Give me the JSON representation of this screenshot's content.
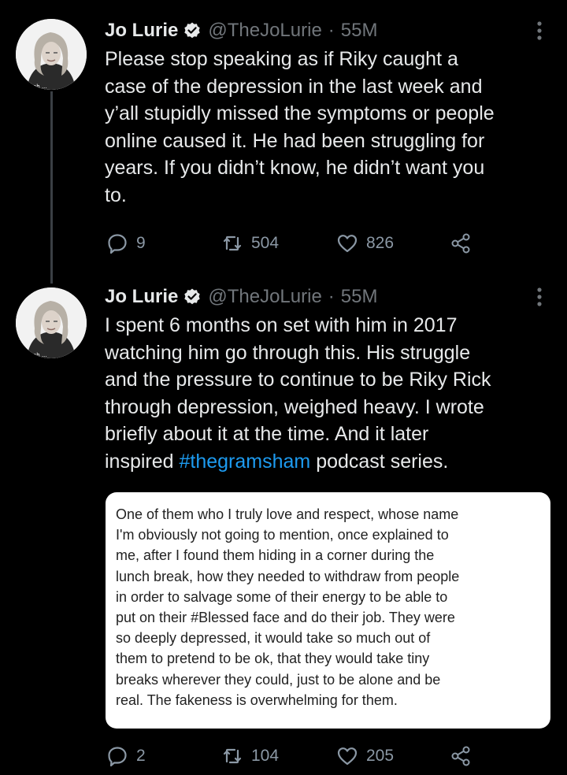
{
  "tweets": [
    {
      "author_name": "Jo Lurie",
      "handle": "@TheJoLurie",
      "separator": "·",
      "time": "55M",
      "lines": [
        "Please stop speaking as if Riky caught a",
        "case of the depression in the last week and",
        "y’all stupidly missed the symptoms or people",
        "online caused it. He had been struggling for",
        "years. If you didn’t know, he didn’t want you",
        "to."
      ],
      "replies": "9",
      "retweets": "504",
      "likes": "826"
    },
    {
      "author_name": "Jo Lurie",
      "handle": "@TheJoLurie",
      "separator": "·",
      "time": "55M",
      "lines": [
        "I spent 6 months on set with him in 2017",
        "watching him go through this. His struggle",
        "and the pressure to continue to be Riky Rick",
        "through depression, weighed heavy. I wrote",
        "briefly about it at the time. And it later"
      ],
      "last_line_prefix": "inspired ",
      "hashtag": "#thegramsham",
      "last_line_suffix": " podcast series.",
      "quote_lines": [
        "One of them who I truly love and respect, whose name",
        "I'm obviously not going to mention, once explained to",
        "me, after I found them hiding in a corner during the",
        "lunch break, how they needed to withdraw from people",
        "in order to salvage some of their energy to be able to",
        "put on their #Blessed face and do their job. They were",
        "so deeply depressed, it would take so much out of",
        "them to pretend to be ok, that they would take tiny",
        "breaks wherever they could, just to be alone and be",
        "real. The fakeness is overwhelming for them."
      ],
      "replies": "2",
      "retweets": "104",
      "likes": "205"
    }
  ],
  "colors": {
    "background": "#000000",
    "text": "#e7e9ea",
    "muted": "#71767b",
    "hashtag": "#1d9bf0",
    "thread_line": "#3a3f44"
  },
  "icons": [
    "verified-badge-icon",
    "more-icon",
    "reply-icon",
    "retweet-icon",
    "like-icon",
    "share-icon"
  ]
}
